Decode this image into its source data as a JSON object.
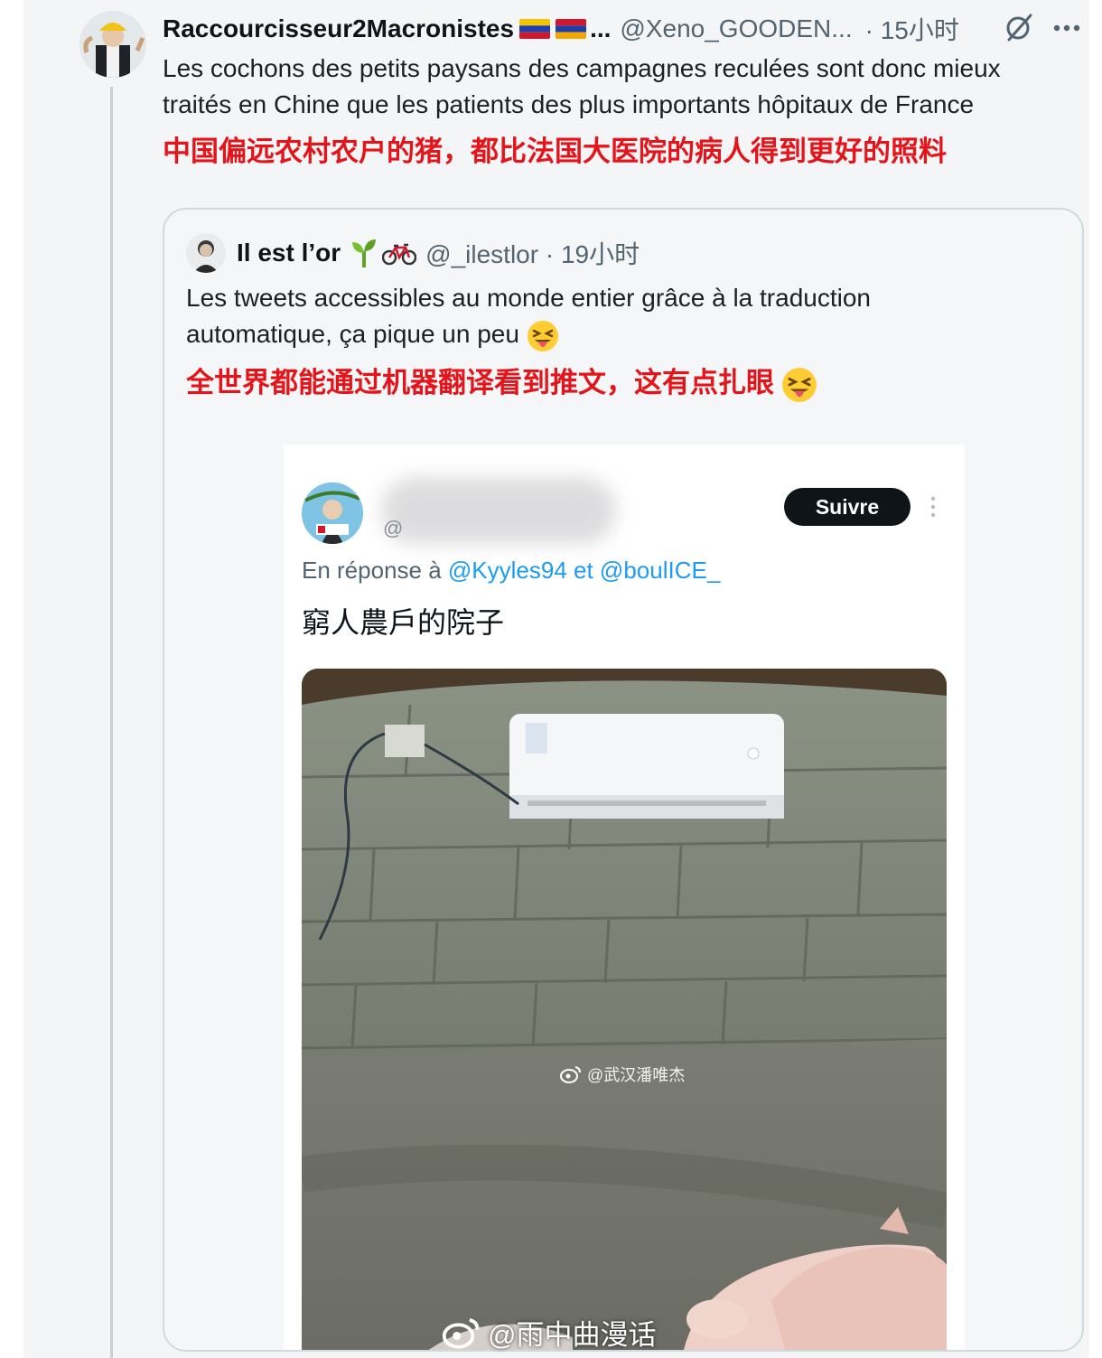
{
  "main_tweet": {
    "author_name": "Raccourcisseur2Macronistes",
    "ellipsis": "...",
    "handle": "@Xeno_GOODEN...",
    "time": "· 15小时",
    "text_fr": "Les cochons des petits paysans des campagnes reculées sont donc mieux traités en Chine que les patients des plus importants hôpitaux de France",
    "text_zh": "中国偏远农村农户的猪，都比法国大医院的病人得到更好的照料"
  },
  "quoted_tweet": {
    "author_name": "Il est l’or",
    "handle": "@_ilestlor · 19小时",
    "text_fr": "Les tweets accessibles au monde entier grâce à la traduction automatique, ça pique un peu",
    "text_zh": "全世界都能通过机器翻译看到推文，这有点扎眼"
  },
  "embedded_screenshot": {
    "handle_partial": "@",
    "follow_button": "Suivre",
    "reply_prefix": "En réponse à",
    "reply_mentions": "@Kyyles94 et @boulICE_",
    "text": "窮人農戶的院子",
    "photo_watermark": "@武汉潘唯杰"
  },
  "page_watermark": "@雨中曲漫话",
  "colors": {
    "accent_red": "#e5141a",
    "link_blue": "#1d9bf0",
    "muted": "#536471"
  }
}
